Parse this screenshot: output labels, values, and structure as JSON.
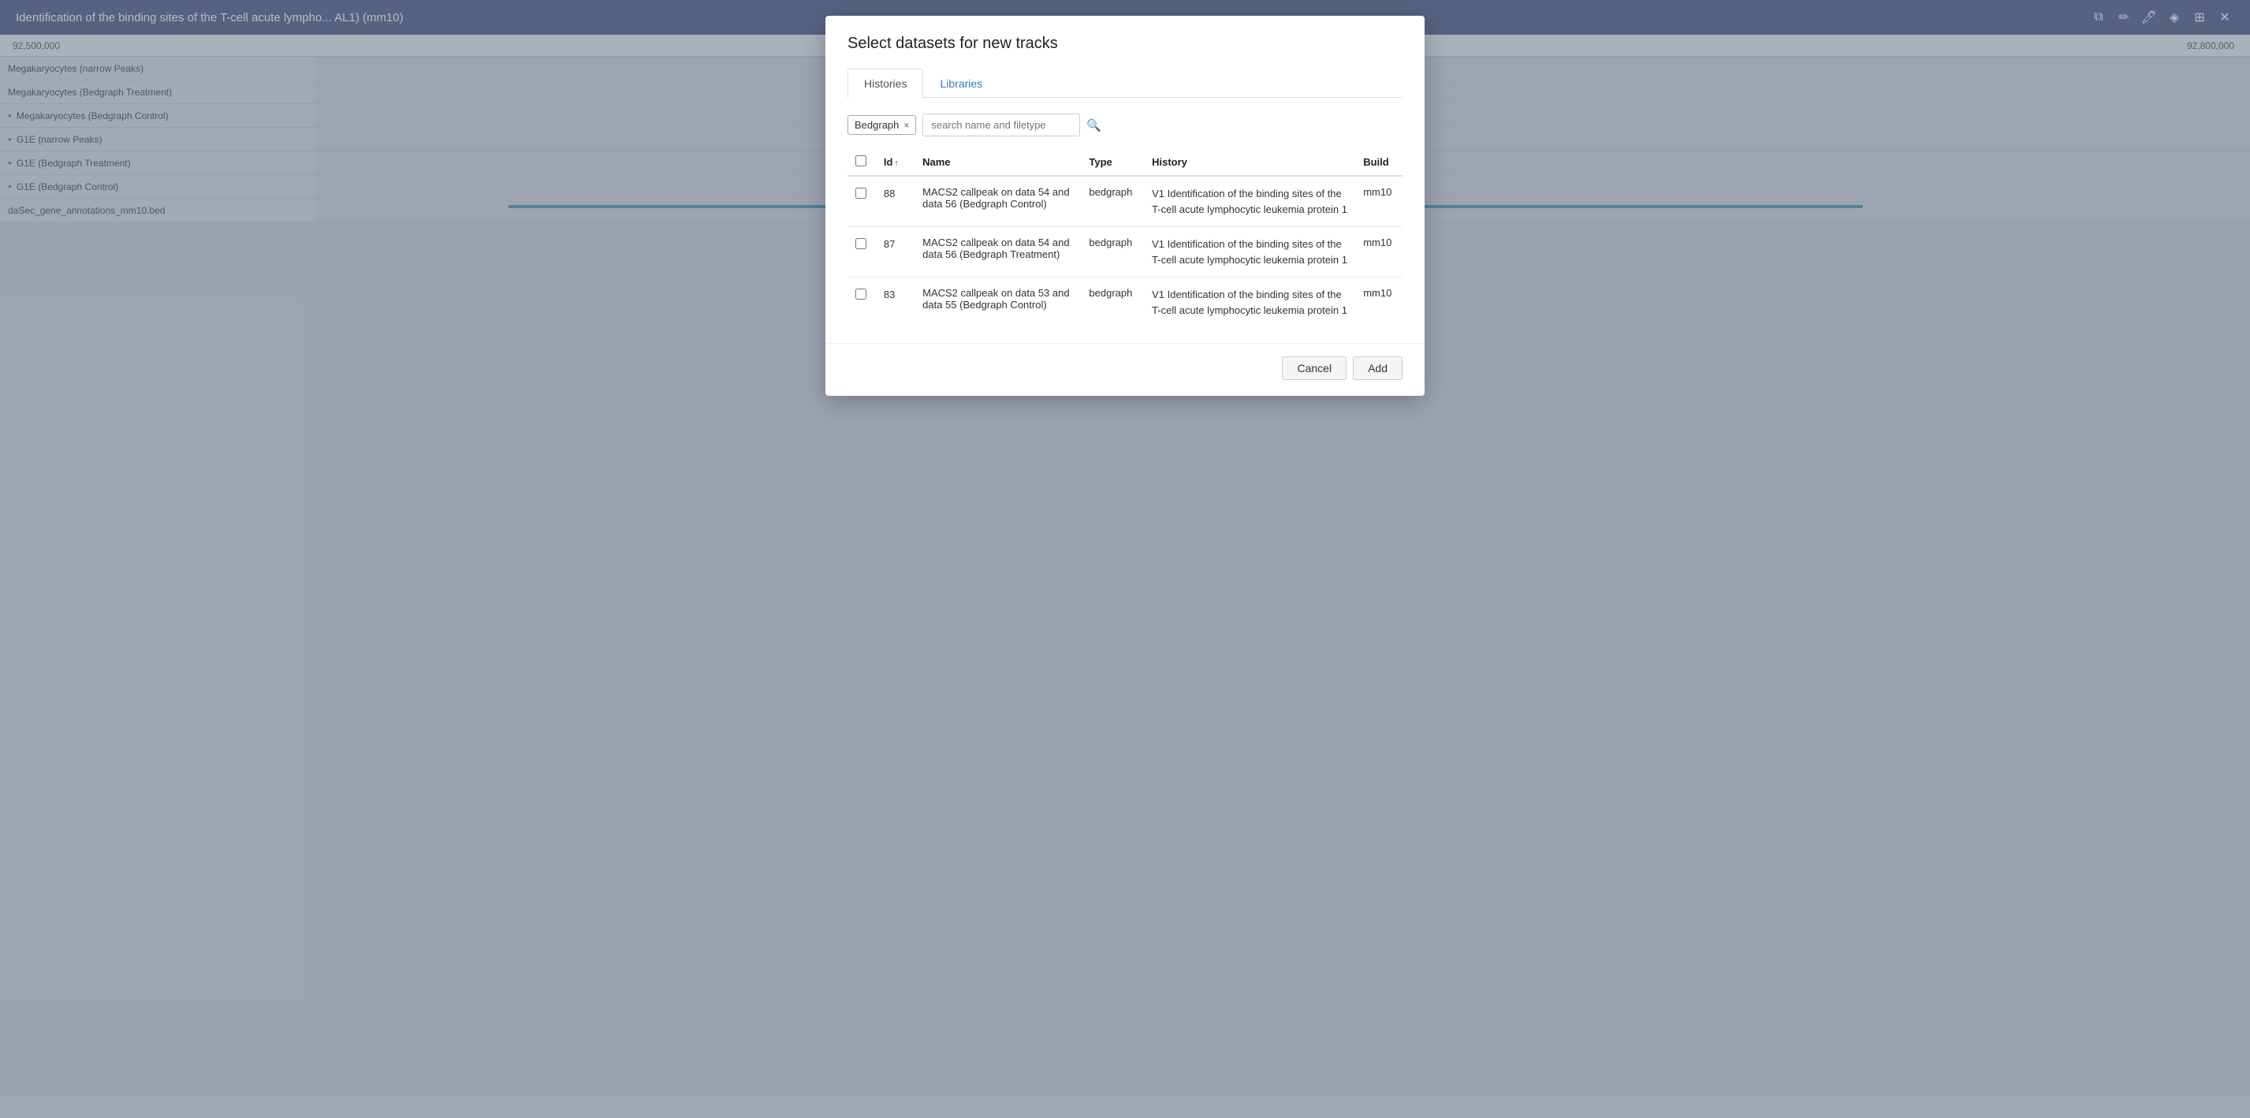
{
  "page": {
    "title": "Identification of the binding sites of the T-cell acute lympho... AL1) (mm10)"
  },
  "toolbar_icons": [
    "copy-icon",
    "edit-icon",
    "pencil-icon",
    "bookmark-icon",
    "export-icon",
    "close-icon"
  ],
  "coordinates": {
    "left": "92,500,000",
    "right": "92,800,000"
  },
  "tracks": [
    {
      "label": "Megakaryocytes (narrow Peaks)",
      "has_dot": false
    },
    {
      "label": "Megakaryocytes (Bedgraph Treatment)",
      "has_dot": false
    },
    {
      "label": "Megakaryocytes (Bedgraph Control)",
      "has_dot": true
    },
    {
      "label": "G1E (narrow Peaks)",
      "has_dot": true
    },
    {
      "label": "G1E (Bedgraph Treatment)",
      "has_dot": true
    },
    {
      "label": "G1E (Bedgraph Control)",
      "has_dot": true
    },
    {
      "label": "daSec_gene_annotations_mm10.bed",
      "has_dot": false
    }
  ],
  "modal": {
    "title": "Select datasets for new tracks",
    "tabs": [
      {
        "label": "Histories",
        "active": true
      },
      {
        "label": "Libraries",
        "active": false
      }
    ],
    "filter_tag": {
      "label": "Bedgraph",
      "x_label": "×"
    },
    "search": {
      "placeholder": "search name and filetype"
    },
    "table": {
      "columns": [
        {
          "label": "",
          "key": "check"
        },
        {
          "label": "Id",
          "key": "id",
          "sortable": true,
          "sort_dir": "↑"
        },
        {
          "label": "Name",
          "key": "name",
          "sortable": false
        },
        {
          "label": "Type",
          "key": "type",
          "sortable": false
        },
        {
          "label": "History",
          "key": "history",
          "sortable": false
        },
        {
          "label": "Build",
          "key": "build",
          "sortable": false
        }
      ],
      "rows": [
        {
          "id": "88",
          "name": "MACS2 callpeak on data 54 and data 56 (Bedgraph Control)",
          "type": "bedgraph",
          "history": "V1 Identification of the binding sites of the T-cell acute lymphocytic leukemia protein 1",
          "build": "mm10"
        },
        {
          "id": "87",
          "name": "MACS2 callpeak on data 54 and data 56 (Bedgraph Treatment)",
          "type": "bedgraph",
          "history": "V1 Identification of the binding sites of the T-cell acute lymphocytic leukemia protein 1",
          "build": "mm10"
        },
        {
          "id": "83",
          "name": "MACS2 callpeak on data 53 and data 55 (Bedgraph Control)",
          "type": "bedgraph",
          "history": "V1 Identification of the binding sites of the T-cell acute lymphocytic leukemia protein 1",
          "build": "mm10"
        }
      ]
    },
    "buttons": {
      "cancel": "Cancel",
      "add": "Add"
    }
  }
}
